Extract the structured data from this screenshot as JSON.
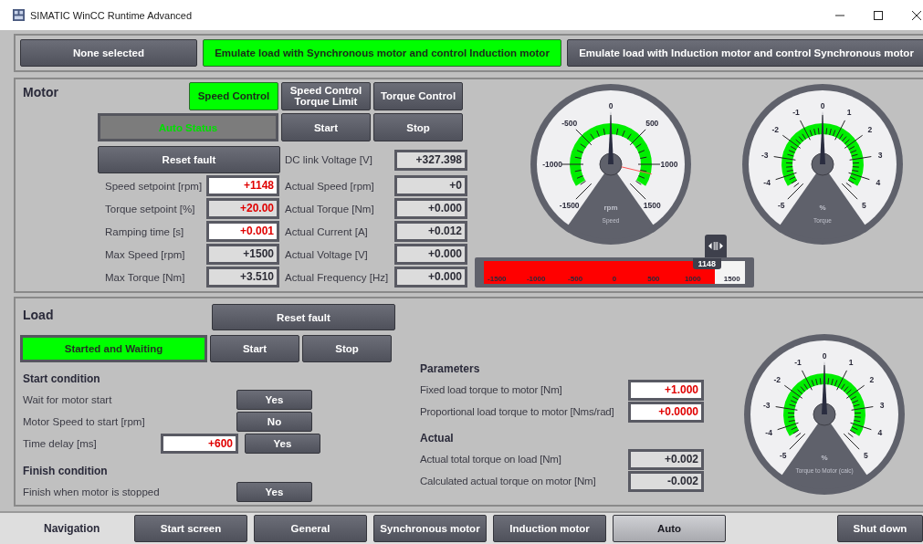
{
  "window": {
    "title": "SIMATIC WinCC Runtime Advanced"
  },
  "modes": [
    {
      "label": "None selected",
      "selected": false
    },
    {
      "label": "Emulate load with Synchronous motor and control Induction motor",
      "selected": true
    },
    {
      "label": "Emulate load with Induction motor and control Synchronous motor",
      "selected": false
    }
  ],
  "motor": {
    "title": "Motor",
    "control_modes": [
      {
        "label": "Speed Control",
        "selected": true
      },
      {
        "label": "Speed Control Torque Limit",
        "selected": false
      },
      {
        "label": "Torque Control",
        "selected": false
      }
    ],
    "status": {
      "label": "Auto Status",
      "active": false
    },
    "start": "Start",
    "stop": "Stop",
    "reset": "Reset fault",
    "setpoints": [
      {
        "label": "Speed setpoint [rpm]",
        "value": "+1148",
        "kind": "input"
      },
      {
        "label": "Torque setpoint [%]",
        "value": "+20.00",
        "kind": "setting"
      },
      {
        "label": "Ramping time [s]",
        "value": "+0.001",
        "kind": "input"
      },
      {
        "label": "Max Speed [rpm]",
        "value": "+1500",
        "kind": "display"
      },
      {
        "label": "Max Torque [Nm]",
        "value": "+3.510",
        "kind": "display"
      }
    ],
    "actuals": [
      {
        "label": "DC link Voltage [V]",
        "value": "+327.398"
      },
      {
        "label": "Actual Speed [rpm]",
        "value": "+0"
      },
      {
        "label": "Actual Torque [Nm]",
        "value": "+0.000"
      },
      {
        "label": "Actual Current [A]",
        "value": "+0.012"
      },
      {
        "label": "Actual Voltage [V]",
        "value": "+0.000"
      },
      {
        "label": "Actual Frequency [Hz]",
        "value": "+0.000"
      }
    ],
    "gauges": [
      {
        "unit": "rpm",
        "title": "Speed",
        "ticks": [
          "-1500",
          "-1000",
          "-500",
          "0",
          "500",
          "1000",
          "1500"
        ]
      },
      {
        "unit": "%",
        "title": "Torque",
        "ticks": [
          "-5",
          "-4",
          "-3",
          "-2",
          "-1",
          "0",
          "1",
          "2",
          "3",
          "4",
          "5"
        ]
      }
    ],
    "slider": {
      "level": 0.883,
      "value": "1148",
      "ticks": [
        "-1500",
        "-1000",
        "-500",
        "0",
        "500",
        "1000",
        "1500"
      ]
    }
  },
  "load": {
    "title": "Load",
    "reset": "Reset fault",
    "status": {
      "label": "Started and Waiting",
      "active": true
    },
    "start": "Start",
    "stop": "Stop",
    "start_condition": {
      "heading": "Start condition",
      "rows": [
        {
          "label": "Wait for motor start",
          "toggle": "Yes"
        },
        {
          "label": "Motor Speed to start [rpm]",
          "toggle": "No"
        },
        {
          "label": "Time delay [ms]",
          "value": "+600",
          "toggle": "Yes"
        }
      ]
    },
    "finish_condition": {
      "heading": "Finish condition",
      "rows": [
        {
          "label": "Finish when motor is stopped",
          "toggle": "Yes"
        }
      ]
    },
    "parameters": {
      "heading": "Parameters",
      "rows": [
        {
          "label": "Fixed load torque to motor [Nm]",
          "value": "+1.000",
          "kind": "input"
        },
        {
          "label": "Proportional load torque to motor [Nms/rad]",
          "value": "+0.0000",
          "kind": "input"
        }
      ]
    },
    "actual": {
      "heading": "Actual",
      "rows": [
        {
          "label": "Actual total torque on load  [Nm]",
          "value": "+0.002",
          "kind": "display"
        },
        {
          "label": "Calculated actual torque on motor  [Nm]",
          "value": "-0.002",
          "kind": "display"
        }
      ]
    },
    "gauge": {
      "unit": "%",
      "title": "Torque to Motor (calc)",
      "ticks": [
        "-5",
        "-4",
        "-3",
        "-2",
        "-1",
        "0",
        "1",
        "2",
        "3",
        "4",
        "5"
      ]
    }
  },
  "navigation": {
    "label": "Navigation",
    "buttons": [
      {
        "label": "Start screen",
        "selected": false
      },
      {
        "label": "General",
        "selected": false
      },
      {
        "label": "Synchronous motor",
        "selected": false
      },
      {
        "label": "Induction motor",
        "selected": false
      },
      {
        "label": "Auto",
        "selected": true
      }
    ],
    "shutdown": "Shut down"
  }
}
